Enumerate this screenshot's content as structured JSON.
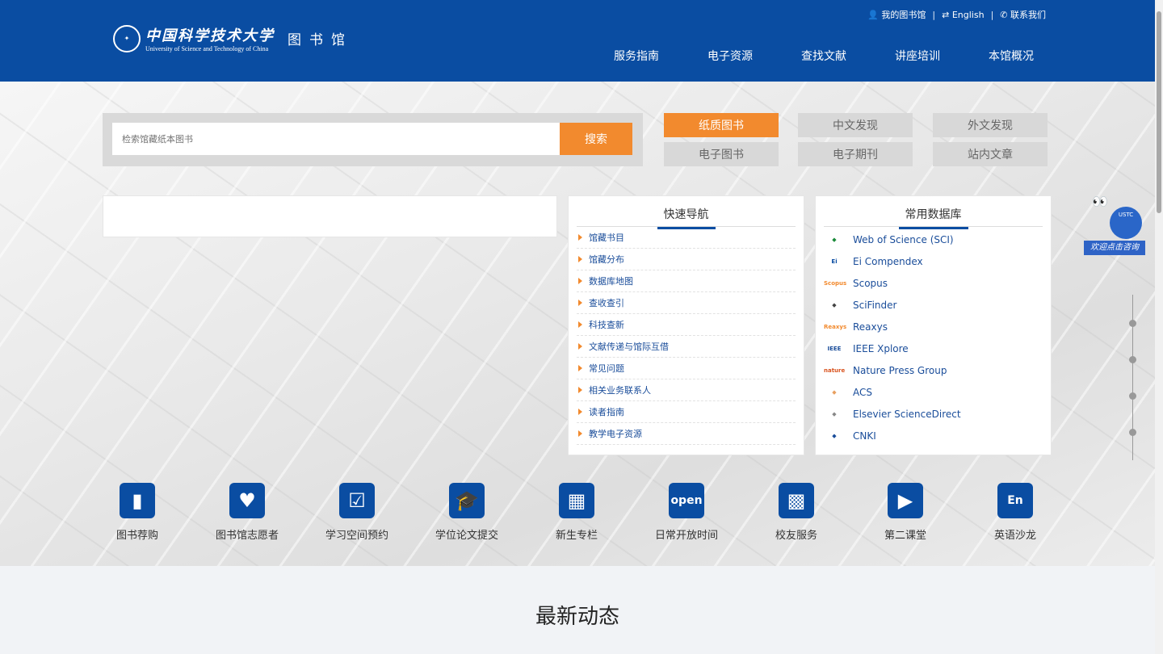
{
  "header": {
    "logo_cn": "中国科学技术大学",
    "logo_en": "University of Science and Technology of China",
    "library": "图书馆",
    "top_links": [
      {
        "icon": "user-icon",
        "label": "我的图书馆"
      },
      {
        "icon": "swap-icon",
        "label": "English"
      },
      {
        "icon": "phone-icon",
        "label": "联系我们"
      }
    ],
    "nav": [
      "服务指南",
      "电子资源",
      "查找文献",
      "讲座培训",
      "本馆概况"
    ]
  },
  "search": {
    "placeholder": "检索馆藏纸本图书",
    "button": "搜索",
    "tabs": [
      {
        "label": "纸质图书",
        "active": true
      },
      {
        "label": "中文发现"
      },
      {
        "label": "外文发现"
      },
      {
        "label": "电子图书"
      },
      {
        "label": "电子期刊"
      },
      {
        "label": "站内文章"
      }
    ]
  },
  "quick_nav": {
    "title": "快速导航",
    "items": [
      "馆藏书目",
      "馆藏分布",
      "数据库地图",
      "查收查引",
      "科技查新",
      "文献传递与馆际互借",
      "常见问题",
      "相关业务联系人",
      "读者指南",
      "教学电子资源"
    ]
  },
  "databases": {
    "title": "常用数据库",
    "items": [
      {
        "label": "Web of Science (SCI)",
        "logo": "",
        "color": "#1a8a3a"
      },
      {
        "label": "Ei Compendex",
        "logo": "Ei",
        "color": "#0a4da2"
      },
      {
        "label": "Scopus",
        "logo": "Scopus",
        "color": "#f28a2e"
      },
      {
        "label": "SciFinder",
        "logo": "",
        "color": "#444"
      },
      {
        "label": "Reaxys",
        "logo": "Reaxys",
        "color": "#f28a2e"
      },
      {
        "label": "IEEE Xplore",
        "logo": "IEEE",
        "color": "#1a4d9a"
      },
      {
        "label": "Nature Press Group",
        "logo": "nature",
        "color": "#d9531e"
      },
      {
        "label": "ACS",
        "logo": "",
        "color": "#e8a060"
      },
      {
        "label": "Elsevier ScienceDirect",
        "logo": "",
        "color": "#888"
      },
      {
        "label": "CNKI",
        "logo": "",
        "color": "#1a4d9a"
      }
    ]
  },
  "services": [
    {
      "label": "图书荐购",
      "icon": "book-icon"
    },
    {
      "label": "图书馆志愿者",
      "icon": "heart-icon"
    },
    {
      "label": "学习空间预约",
      "icon": "calendar-check-icon"
    },
    {
      "label": "学位论文提交",
      "icon": "graduation-cap-icon"
    },
    {
      "label": "新生专栏",
      "icon": "grid-icon"
    },
    {
      "label": "日常开放时间",
      "icon": "open-sign-icon",
      "glyph": "open"
    },
    {
      "label": "校友服务",
      "icon": "tiles-icon"
    },
    {
      "label": "第二课堂",
      "icon": "play-icon"
    },
    {
      "label": "英语沙龙",
      "icon": "en-icon",
      "glyph": "En"
    }
  ],
  "mascot": {
    "banner": "欢迎点击咨询",
    "shell_text": "USTC"
  },
  "news": {
    "title": "最新动态"
  },
  "colors": {
    "brand": "#0a4da2",
    "accent": "#f28a2e"
  }
}
